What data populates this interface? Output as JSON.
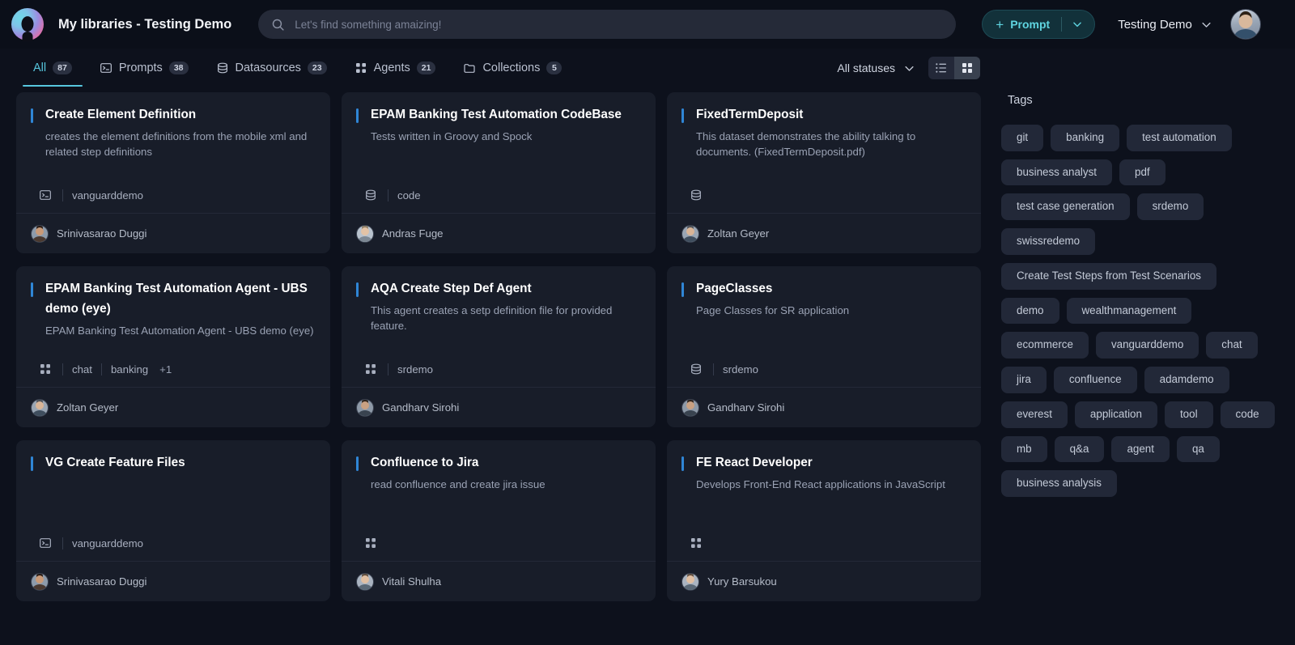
{
  "header": {
    "app_title": "My libraries - Testing Demo",
    "search": {
      "placeholder": "Let's find something amaizing!",
      "value": ""
    },
    "prompt_button": {
      "label": "Prompt",
      "plus": "+",
      "accent": "#5fd4e0"
    },
    "account_name": "Testing Demo"
  },
  "tabs": [
    {
      "label": "All",
      "count": "87",
      "icon": "none",
      "active": true
    },
    {
      "label": "Prompts",
      "count": "38",
      "icon": "terminal-icon",
      "active": false
    },
    {
      "label": "Datasources",
      "count": "23",
      "icon": "database-icon",
      "active": false
    },
    {
      "label": "Agents",
      "count": "21",
      "icon": "grid-squares-icon",
      "active": false
    },
    {
      "label": "Collections",
      "count": "5",
      "icon": "folder-icon",
      "active": false
    }
  ],
  "toolbar": {
    "status_filter": "All statuses",
    "view_list": "list-view",
    "view_grid": "grid-view",
    "active_view": "grid"
  },
  "cards": [
    {
      "title": "Create Element Definition",
      "description": "creates the element definitions from the mobile xml and related step definitions",
      "type_icon": "terminal-icon",
      "tags": [
        "vanguarddemo"
      ],
      "more": "",
      "author": "Srinivasarao Duggi",
      "avatar": "av-a"
    },
    {
      "title": "EPAM Banking Test Automation CodeBase",
      "description": "Tests written in Groovy and Spock",
      "type_icon": "database-icon",
      "tags": [
        "code"
      ],
      "more": "",
      "author": "Andras Fuge",
      "avatar": "av-b"
    },
    {
      "title": "FixedTermDeposit",
      "description": "This dataset demonstrates the ability talking to documents. (FixedTermDeposit.pdf)",
      "type_icon": "database-icon",
      "tags": [],
      "more": "",
      "author": "Zoltan Geyer",
      "avatar": "av-c"
    },
    {
      "title": "EPAM Banking Test Automation Agent - UBS demo (eye)",
      "description": "EPAM Banking Test Automation Agent - UBS demo (eye)",
      "type_icon": "grid-squares-icon",
      "tags": [
        "chat",
        "banking"
      ],
      "more": "+1",
      "author": "Zoltan Geyer",
      "avatar": "av-c"
    },
    {
      "title": "AQA Create Step Def Agent",
      "description": "This agent creates a setp definition file for provided feature.",
      "type_icon": "grid-squares-icon",
      "tags": [
        "srdemo"
      ],
      "more": "",
      "author": "Gandharv Sirohi",
      "avatar": "av-d"
    },
    {
      "title": "PageClasses",
      "description": "Page Classes for SR application",
      "type_icon": "database-icon",
      "tags": [
        "srdemo"
      ],
      "more": "",
      "author": "Gandharv Sirohi",
      "avatar": "av-d"
    },
    {
      "title": "VG Create Feature Files",
      "description": "",
      "type_icon": "terminal-icon",
      "tags": [
        "vanguarddemo"
      ],
      "more": "",
      "author": "Srinivasarao Duggi",
      "avatar": "av-a"
    },
    {
      "title": "Confluence to Jira",
      "description": "read confluence and create jira issue",
      "type_icon": "grid-squares-icon",
      "tags": [],
      "more": "",
      "author": "Vitali Shulha",
      "avatar": "av-e"
    },
    {
      "title": "FE React Developer",
      "description": "Develops Front-End React applications in JavaScript",
      "type_icon": "grid-squares-icon",
      "tags": [],
      "more": "",
      "author": "Yury Barsukou",
      "avatar": "av-e"
    }
  ],
  "tags_panel": {
    "title": "Tags",
    "tags": [
      "git",
      "banking",
      "test automation",
      "business analyst",
      "pdf",
      "test case generation",
      "srdemo",
      "swissredemo",
      "Create Test Steps from Test Scenarios",
      "demo",
      "wealthmanagement",
      "ecommerce",
      "vanguarddemo",
      "chat",
      "jira",
      "confluence",
      "adamdemo",
      "everest",
      "application",
      "tool",
      "code",
      "mb",
      "q&a",
      "agent",
      "qa",
      "business analysis"
    ]
  },
  "colors": {
    "page_bg": "#0d111c",
    "card_bg": "#181d29",
    "accent_teal": "#57c7de",
    "card_accent_bar": "#2f86d6",
    "tag_bg": "#222838"
  }
}
